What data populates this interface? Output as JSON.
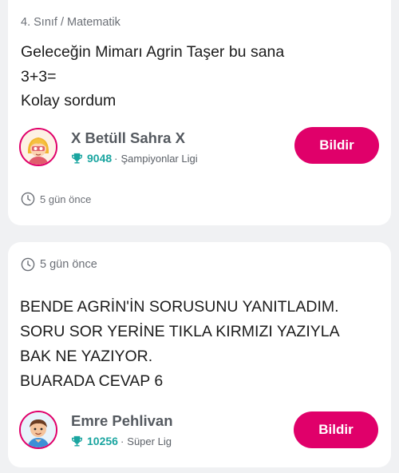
{
  "question_card": {
    "breadcrumb": "4. Sınıf / Matematik",
    "lines": [
      "Geleceğin Mimarı Agrin Taşer bu sana",
      "3+3=",
      "Kolay sordum"
    ],
    "user": {
      "name": "X Betüll Sahra X",
      "points": "9048",
      "league": "Şampiyonlar Ligi"
    },
    "report_label": "Bildir",
    "time": "5 gün önce"
  },
  "answer_card": {
    "time": "5 gün önce",
    "lines": [
      "BENDE AGRİN'İN SORUSUNU YANITLADIM.",
      "SORU SOR YERİNE TIKLA KIRMIZI YAZIYLA",
      "BAK NE YAZIYOR.",
      "BUARADA CEVAP 6"
    ],
    "user": {
      "name": "Emre Pehlivan",
      "points": "10256",
      "league": "Süper Lig"
    },
    "report_label": "Bildir"
  },
  "colors": {
    "accent": "#e0006a",
    "points": "#1aa5a0",
    "background": "#f0f1f3"
  }
}
